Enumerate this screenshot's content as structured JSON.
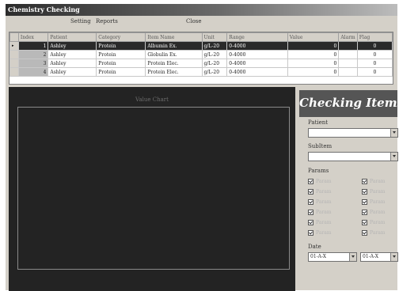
{
  "window": {
    "title": "Chemistry Checking"
  },
  "menu": {
    "items": [
      {
        "label": "Setting",
        "enabled": true
      },
      {
        "label": "Reports",
        "enabled": true
      },
      {
        "label": "Close",
        "enabled": true
      }
    ]
  },
  "grid": {
    "columns": [
      "Index",
      "Patient",
      "Category",
      "Item Name",
      "Unit",
      "Range",
      "Value",
      "Alarm",
      "Flag"
    ],
    "rows": [
      {
        "indicator": "▸",
        "selected": true,
        "cells": [
          "1",
          "Ashley",
          "Protein",
          "Albumin Ex.",
          "g/L-20",
          "0-4000",
          "0",
          "",
          "0"
        ]
      },
      {
        "indicator": "",
        "selected": false,
        "cells": [
          "2",
          "Ashley",
          "Protein",
          "Globulin Ex.",
          "g/L-20",
          "0-4000",
          "0",
          "",
          "0"
        ]
      },
      {
        "indicator": "",
        "selected": false,
        "cells": [
          "3",
          "Ashley",
          "Protein",
          "Protein Elec.",
          "g/L-20",
          "0-4000",
          "0",
          "",
          "0"
        ]
      },
      {
        "indicator": "",
        "selected": false,
        "cells": [
          "4",
          "Ashley",
          "Protein",
          "Protein Elec.",
          "g/L-20",
          "0-4000",
          "0",
          "",
          "0"
        ]
      }
    ]
  },
  "chart": {
    "title": "Value Chart"
  },
  "panel": {
    "heading": "Checking Items",
    "patient_label": "Patient",
    "patient_value": "",
    "subitem_label": "SubItem",
    "subitem_value": "",
    "params_label": "Params",
    "params": [
      {
        "label": "Param",
        "checked": true
      },
      {
        "label": "Param",
        "checked": true
      },
      {
        "label": "Param",
        "checked": true
      },
      {
        "label": "Param",
        "checked": true
      },
      {
        "label": "Param",
        "checked": true
      },
      {
        "label": "Param",
        "checked": true
      },
      {
        "label": "Param",
        "checked": true
      },
      {
        "label": "Param",
        "checked": true
      },
      {
        "label": "Param",
        "checked": true
      },
      {
        "label": "Param",
        "checked": true
      },
      {
        "label": "Param",
        "checked": true
      },
      {
        "label": "Param",
        "checked": true
      }
    ],
    "date_label": "Date",
    "date_from": "01-A-X",
    "date_to": "01-A-X"
  },
  "colors": {
    "selection": "#2a2a2a",
    "chart_background": "#232323",
    "banner": "#555555"
  },
  "icons": {
    "combo_button": "chevron-down-icon",
    "row_indicator": "current-row-arrow-icon",
    "param_checkbox": "checkmark-icon"
  }
}
